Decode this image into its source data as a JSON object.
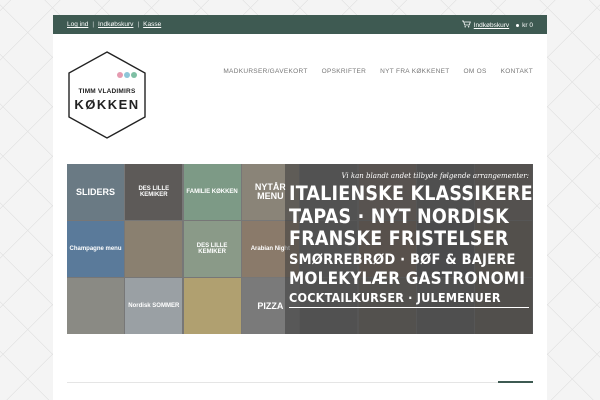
{
  "topbar": {
    "links": [
      "Log ind",
      "Indkøbskurv",
      "Kasse"
    ],
    "cart_label": "Indkøbskurv",
    "cart_amount": "kr 0"
  },
  "logo": {
    "line1": "TIMM VLADIMIRS",
    "line2": "KØKKEN",
    "dot_colors": [
      "#e59bb0",
      "#8ec6d8",
      "#7fbfa4"
    ]
  },
  "nav": {
    "items": [
      "MADKURSER/GAVEKORT",
      "OPSKRIFTER",
      "NYT FRA KØKKENET",
      "OM OS",
      "KONTAKT"
    ]
  },
  "banner": {
    "intro": "Vi kan blandt andet tilbyde følgende arrangementer:",
    "lines": [
      "ITALIENSKE KLASSIKERE",
      "TAPAS · NYT NORDISK",
      "FRANSKE FRISTELSER",
      "SMØRREBRØD · BØF & BAJERE",
      "MOLEKYLÆR GASTRONOMI",
      "COCKTAILKURSER · JULEMENUER"
    ],
    "tiles": [
      {
        "label": "SLIDERS",
        "color": "#6a7a84"
      },
      {
        "label": "DES LILLE KEMIKER",
        "color": "#5d5a58"
      },
      {
        "label": "FAMILIE KØKKEN",
        "color": "#7d9a86"
      },
      {
        "label": "NYTÅR MENU",
        "color": "#8a8478"
      },
      {
        "label": "",
        "color": "#6e6e6e"
      },
      {
        "label": "",
        "color": "#7a6f68"
      },
      {
        "label": "",
        "color": "#666666"
      },
      {
        "label": "",
        "color": "#716a66"
      },
      {
        "label": "Champagne menu",
        "color": "#5a7a9a"
      },
      {
        "label": "",
        "color": "#8a8070"
      },
      {
        "label": "DES LILLE KEMIKER",
        "color": "#8a9a88"
      },
      {
        "label": "Arabian Night",
        "color": "#8a7a6a"
      },
      {
        "label": "",
        "color": "#6a6a6a"
      },
      {
        "label": "",
        "color": "#7a6c60"
      },
      {
        "label": "",
        "color": "#5e5e60"
      },
      {
        "label": "",
        "color": "#706860"
      },
      {
        "label": "",
        "color": "#8a8a84"
      },
      {
        "label": "Nordisk SOMMER",
        "color": "#9aa0a4"
      },
      {
        "label": "",
        "color": "#b0a070"
      },
      {
        "label": "PIZZA",
        "color": "#7a7a7a"
      },
      {
        "label": "",
        "color": "#6a6a6a"
      },
      {
        "label": "",
        "color": "#706a64"
      },
      {
        "label": "",
        "color": "#666666"
      },
      {
        "label": "",
        "color": "#6c6660"
      }
    ]
  },
  "colors": {
    "accent": "#3e5a52"
  }
}
